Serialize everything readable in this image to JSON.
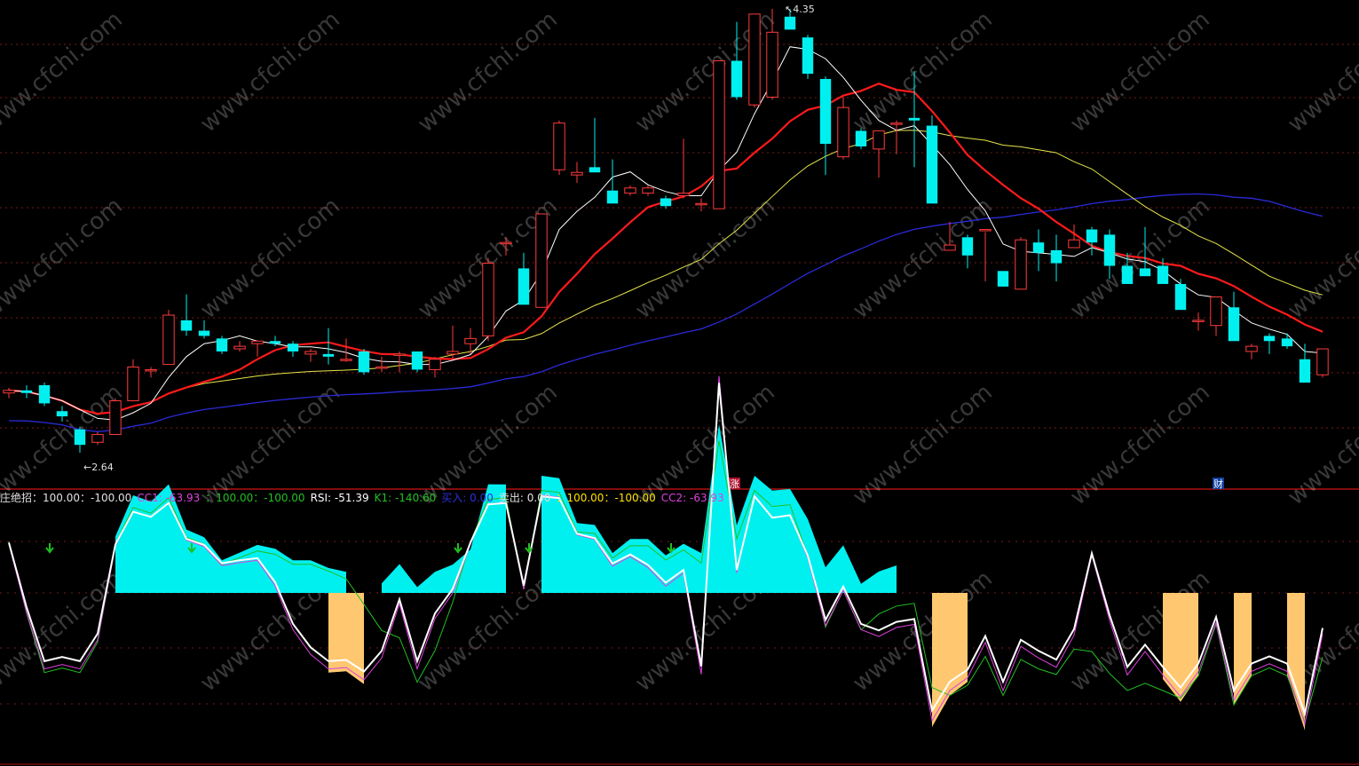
{
  "colors": {
    "up": "#ff3b3b",
    "down": "#00f0f0",
    "ma5": "#ffffff",
    "ma10": "#ff1a1a",
    "ma20": "#e6e64c",
    "ma60": "#2a2ad8",
    "grid": "#7a1a1a",
    "separator": "#b01010",
    "watermark": "#ffffff",
    "white_line": "#ffffff",
    "magenta_line": "#e040e0",
    "green_line": "#22c022",
    "cyan_fill": "#00f0f0",
    "orange_fill": "#ffc870",
    "arrow": "#20c020"
  },
  "price_labels": {
    "high": "4.35",
    "low": "2.64"
  },
  "markers": {
    "zhang": "涨",
    "cai": "财"
  },
  "watermark_text": "www.cfchi.com",
  "indicator_legend": [
    {
      "text": "庄绝招：100.00：-100.00",
      "color": "#e0e0e0"
    },
    {
      "text": "CC1: -63.93",
      "color": "#e040e0"
    },
    {
      "text": "：100.00：-100.00",
      "color": "#22c022"
    },
    {
      "text": "RSI: -51.39",
      "color": "#ffffff"
    },
    {
      "text": "K1: -140.60",
      "color": "#22c022"
    },
    {
      "text": "买入: 0.00",
      "color": "#3030e0"
    },
    {
      "text": "卖出: 0.00",
      "color": "#e0e0e0"
    },
    {
      "text": "：100.00：-100.00",
      "color": "#ffe000"
    },
    {
      "text": "CC2: -63.93",
      "color": "#e040e0"
    }
  ],
  "chart_data": {
    "type": "candlestick",
    "price_axis": {
      "high": 4.35,
      "low": 2.64
    },
    "candles": [
      [
        2.87,
        2.89,
        2.85,
        2.88
      ],
      [
        2.88,
        2.9,
        2.85,
        2.87
      ],
      [
        2.9,
        2.91,
        2.82,
        2.83
      ],
      [
        2.8,
        2.82,
        2.76,
        2.78
      ],
      [
        2.73,
        2.74,
        2.64,
        2.67
      ],
      [
        2.68,
        2.72,
        2.67,
        2.71
      ],
      [
        2.71,
        2.85,
        2.71,
        2.84
      ],
      [
        2.84,
        3.0,
        2.84,
        2.97
      ],
      [
        2.96,
        2.97,
        2.93,
        2.96
      ],
      [
        2.98,
        3.19,
        2.98,
        3.17
      ],
      [
        3.15,
        3.25,
        3.09,
        3.11
      ],
      [
        3.11,
        3.15,
        3.08,
        3.09
      ],
      [
        3.08,
        3.09,
        3.02,
        3.03
      ],
      [
        3.04,
        3.07,
        3.03,
        3.05
      ],
      [
        3.06,
        3.07,
        3.01,
        3.07
      ],
      [
        3.07,
        3.09,
        3.05,
        3.06
      ],
      [
        3.06,
        3.07,
        3.01,
        3.03
      ],
      [
        3.02,
        3.04,
        2.99,
        3.03
      ],
      [
        3.02,
        3.12,
        2.98,
        3.01
      ],
      [
        3.0,
        3.08,
        2.99,
        3.0
      ],
      [
        3.03,
        3.04,
        2.94,
        2.95
      ],
      [
        2.97,
        3.01,
        2.95,
        2.97
      ],
      [
        3.02,
        3.03,
        2.95,
        3.02
      ],
      [
        3.03,
        3.03,
        2.95,
        2.96
      ],
      [
        2.96,
        3.01,
        2.93,
        3.0
      ],
      [
        3.02,
        3.13,
        3.0,
        3.03
      ],
      [
        3.06,
        3.12,
        3.02,
        3.08
      ],
      [
        3.09,
        3.39,
        3.07,
        3.37
      ],
      [
        3.45,
        3.47,
        3.4,
        3.45
      ],
      [
        3.35,
        3.41,
        3.28,
        3.21
      ],
      [
        3.2,
        3.56,
        3.2,
        3.56
      ],
      [
        3.73,
        3.92,
        3.71,
        3.91
      ],
      [
        3.71,
        3.76,
        3.68,
        3.72
      ],
      [
        3.74,
        3.93,
        3.73,
        3.72
      ],
      [
        3.65,
        3.77,
        3.65,
        3.6
      ],
      [
        3.64,
        3.67,
        3.63,
        3.66
      ],
      [
        3.64,
        3.67,
        3.63,
        3.66
      ],
      [
        3.62,
        3.63,
        3.58,
        3.59
      ],
      [
        3.63,
        3.85,
        3.62,
        3.64
      ],
      [
        3.6,
        3.62,
        3.57,
        3.6
      ],
      [
        3.58,
        3.86,
        3.58,
        4.15
      ],
      [
        4.15,
        4.3,
        4.0,
        4.01
      ],
      [
        3.98,
        4.33,
        3.97,
        4.33
      ],
      [
        4.01,
        4.35,
        4.0,
        4.26
      ],
      [
        4.32,
        4.35,
        4.31,
        4.27
      ],
      [
        4.24,
        4.25,
        4.08,
        4.1
      ],
      [
        4.08,
        4.09,
        3.71,
        3.83
      ],
      [
        3.78,
        4.01,
        3.77,
        3.97
      ],
      [
        3.88,
        3.89,
        3.81,
        3.82
      ],
      [
        3.81,
        3.88,
        3.7,
        3.88
      ],
      [
        3.91,
        3.92,
        3.79,
        3.91
      ],
      [
        3.93,
        4.11,
        3.74,
        3.92
      ],
      [
        3.9,
        3.94,
        3.72,
        3.6
      ],
      [
        3.42,
        3.53,
        3.44,
        3.44
      ],
      [
        3.47,
        3.48,
        3.35,
        3.4
      ],
      [
        3.5,
        3.49,
        3.3,
        3.5
      ],
      [
        3.34,
        3.34,
        3.28,
        3.28
      ],
      [
        3.27,
        3.47,
        3.27,
        3.46
      ],
      [
        3.45,
        3.5,
        3.34,
        3.41
      ],
      [
        3.42,
        3.48,
        3.3,
        3.37
      ],
      [
        3.43,
        3.52,
        3.43,
        3.46
      ],
      [
        3.5,
        3.51,
        3.4,
        3.45
      ],
      [
        3.48,
        3.5,
        3.31,
        3.36
      ],
      [
        3.36,
        3.41,
        3.32,
        3.29
      ],
      [
        3.35,
        3.51,
        3.34,
        3.32
      ],
      [
        3.36,
        3.39,
        3.33,
        3.29
      ],
      [
        3.29,
        3.31,
        3.2,
        3.19
      ],
      [
        3.15,
        3.18,
        3.11,
        3.15
      ],
      [
        3.13,
        3.16,
        3.09,
        3.24
      ],
      [
        3.2,
        3.26,
        3.17,
        3.07
      ],
      [
        3.03,
        3.06,
        3.0,
        3.05
      ],
      [
        3.09,
        3.1,
        3.02,
        3.07
      ],
      [
        3.08,
        3.1,
        3.04,
        3.05
      ],
      [
        3.0,
        3.06,
        2.98,
        2.91
      ],
      [
        2.94,
        2.98,
        2.93,
        3.04
      ]
    ]
  }
}
